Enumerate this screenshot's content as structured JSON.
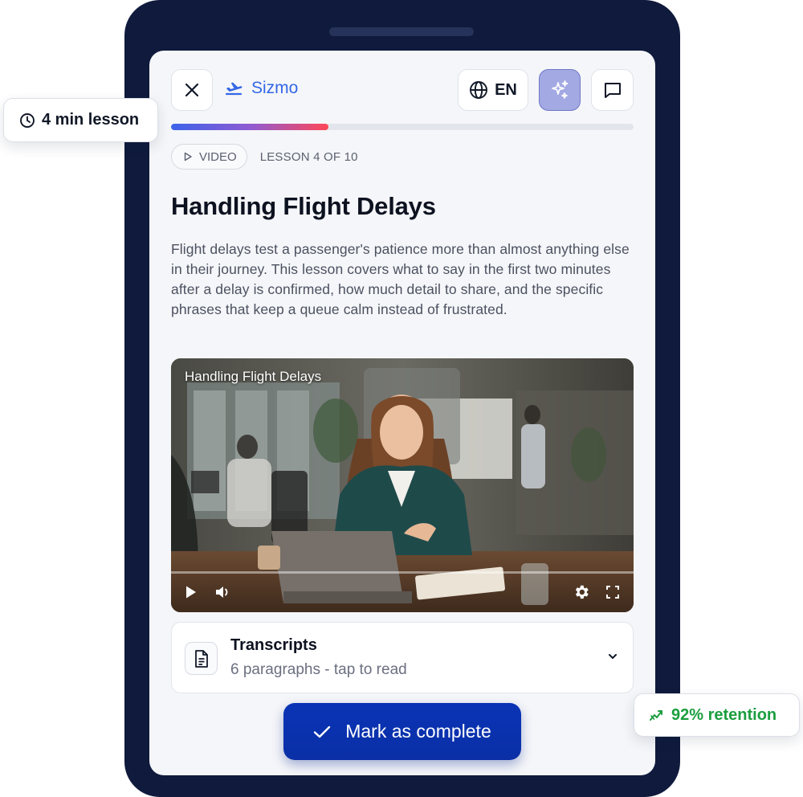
{
  "header": {
    "brand": "Sizmo",
    "language": "EN"
  },
  "progress": {
    "fraction": 0.34
  },
  "lesson": {
    "type_label": "VIDEO",
    "position_label": "LESSON 4 OF 10",
    "title": "Handling Flight Delays",
    "description": "Flight delays test a passenger's patience more than almost anything else in their journey. This lesson covers what to say in the first two minutes after a delay is confirmed, how much detail to share, and the specific phrases that keep a queue calm instead of frustrated."
  },
  "video": {
    "title": "Handling Flight Delays"
  },
  "transcripts": {
    "title": "Transcripts",
    "subtitle": "6 paragraphs - tap to read"
  },
  "actions": {
    "complete_label": "Mark as complete"
  },
  "badges": {
    "duration": "4 min lesson",
    "retention": "92% retention"
  },
  "icons": {
    "close": "close-icon",
    "brand": "plane-departure-icon",
    "language": "globe-icon",
    "ai": "sparkles-icon",
    "chat": "chat-bubble-icon",
    "video_type": "play-outline-icon",
    "play": "play-icon",
    "volume": "volume-icon",
    "settings": "gear-icon",
    "fullscreen": "fullscreen-icon",
    "document": "document-icon",
    "chevron": "chevron-down-icon",
    "check": "check-icon",
    "clock": "clock-icon",
    "trend": "trend-up-icon"
  },
  "colors": {
    "device_frame": "#0f1a3c",
    "brand_blue": "#3467e6",
    "primary_button": "#0a34b6",
    "ai_button": "#a3a9e2",
    "retention_green": "#1b9e3e",
    "progress_start": "#3d63ea",
    "progress_end": "#ff4757"
  }
}
